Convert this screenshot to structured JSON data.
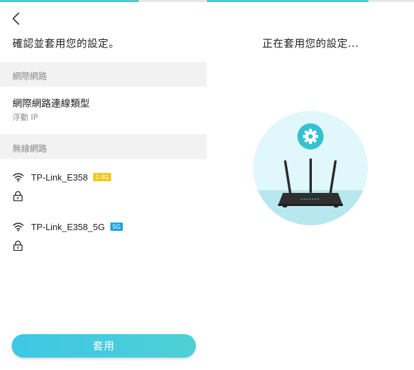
{
  "left_screen": {
    "title": "確認並套用您的設定。",
    "progress": 0.67,
    "internet_section": {
      "header": "網際網路",
      "connection_type_label": "網際網路連線類型",
      "connection_type_value": "浮動 IP"
    },
    "wireless_section": {
      "header": "無線網路",
      "networks": [
        {
          "ssid": "TP-Link_E358",
          "band": "2.4G",
          "band_color": "#f5c518",
          "icon": "wifi-icon",
          "security_icon": "lock-icon"
        },
        {
          "ssid": "TP-Link_E358_5G",
          "band": "5G",
          "band_color": "#1aa3e0",
          "icon": "wifi-icon",
          "security_icon": "lock-icon"
        }
      ]
    },
    "apply_button": "套用"
  },
  "right_screen": {
    "status": "正在套用您的設定...",
    "progress": 0.78,
    "illustration_icons": [
      "gear-icon",
      "router-icon"
    ]
  },
  "colors": {
    "accent": "#4acbd6",
    "section_bg": "#f2f2f2",
    "illustration_circle": "#e0f7fb",
    "illustration_floor": "#b9e7f0",
    "gear_circle": "#35c1d0"
  }
}
